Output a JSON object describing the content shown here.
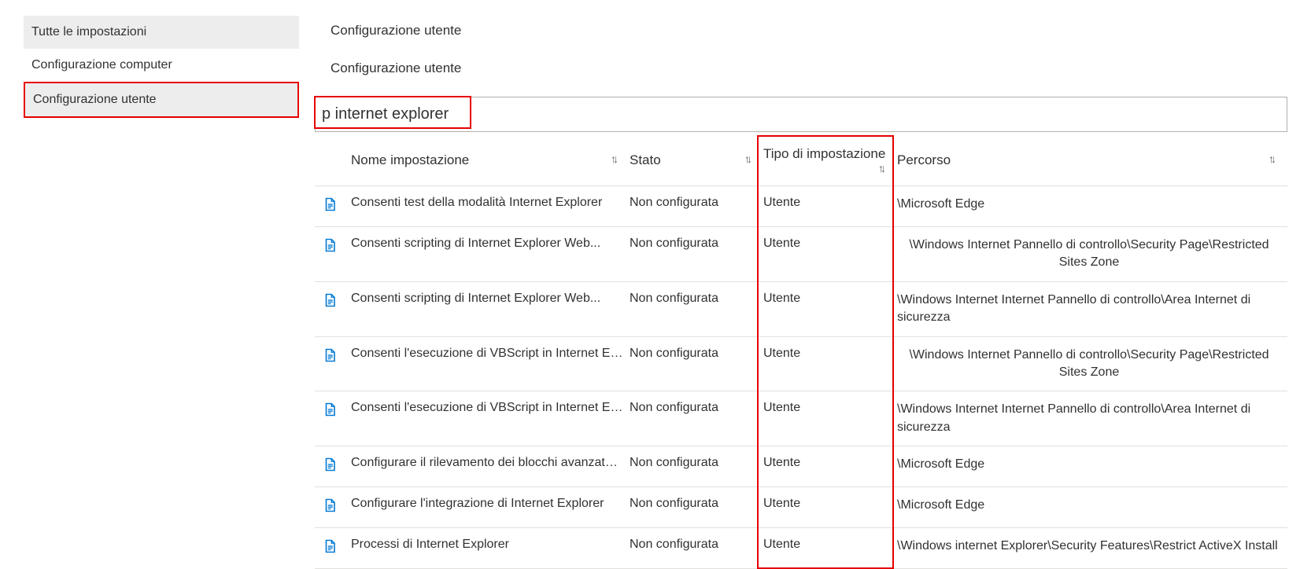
{
  "sidebar": {
    "items": [
      {
        "label": "Tutte le impostazioni",
        "active": true,
        "highlight": false
      },
      {
        "label": "Configurazione computer",
        "active": false,
        "highlight": false
      },
      {
        "label": "Configurazione utente",
        "active": true,
        "highlight": true
      }
    ]
  },
  "breadcrumb": {
    "line1": "Configurazione utente",
    "line2": "Configurazione utente"
  },
  "search": {
    "value": "p internet explorer"
  },
  "columns": {
    "name": "Nome impostazione",
    "state": "Stato",
    "type": "Tipo di impostazione",
    "path": "Percorso"
  },
  "sort_glyph": "↑↓",
  "rows": [
    {
      "name": "Consenti test della modalità Internet Explorer",
      "state": "Non configurata",
      "type": "Utente",
      "path": "\\Microsoft Edge",
      "small": false,
      "path_center": false
    },
    {
      "name": "Consenti scripting di Internet Explorer Web...",
      "state": "Non configurata",
      "type": "Utente",
      "path": "\\Windows Internet Pannello di controllo\\Security Page\\Restricted Sites Zone",
      "small": false,
      "path_center": true
    },
    {
      "name": "Consenti scripting di Internet Explorer Web...",
      "state": "Non configurata",
      "type": "Utente",
      "path": "\\Windows Internet Internet Pannello di controllo\\Area Internet di sicurezza",
      "small": false,
      "path_center": false
    },
    {
      "name": "Consenti l'esecuzione di VBScript in Internet Explorer",
      "state": "Non configurata",
      "type": "Utente",
      "path": "\\Windows Internet Pannello di controllo\\Security Page\\Restricted Sites Zone",
      "small": true,
      "path_center": true
    },
    {
      "name": "Consenti l'esecuzione di VBScript in Internet Explorer",
      "state": "Non configurata",
      "type": "Utente",
      "path": "\\Windows Internet Internet Pannello di controllo\\Area Internet di sicurezza",
      "small": true,
      "path_center": false
    },
    {
      "name": "Configurare il rilevamento dei blocchi avanzato per ...",
      "state": "Non configurata",
      "type": "Utente",
      "path": "\\Microsoft Edge",
      "small": true,
      "path_center": false
    },
    {
      "name": "Configurare l'integrazione di Internet Explorer",
      "state": "Non configurata",
      "type": "Utente",
      "path": "\\Microsoft Edge",
      "small": false,
      "path_center": false
    },
    {
      "name": "Processi di Internet Explorer",
      "state": "Non configurata",
      "type": "Utente",
      "path": "\\Windows internet Explorer\\Security Features\\Restrict ActiveX Install",
      "small": false,
      "path_center": false
    }
  ],
  "icon_color": "#0078d4"
}
